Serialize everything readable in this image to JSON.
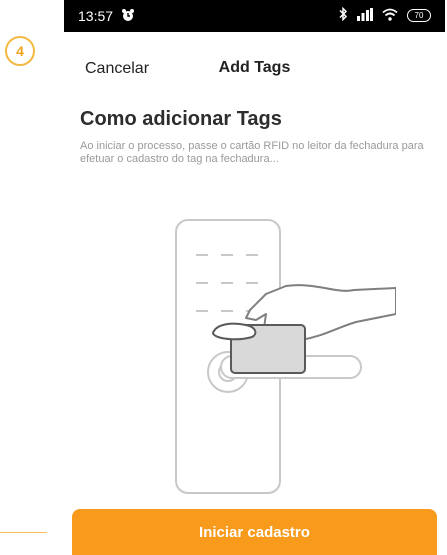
{
  "step": {
    "number": "4",
    "color": "#f4b740"
  },
  "status_bar": {
    "time": "13:57",
    "battery": "70",
    "icons": [
      "alarm-icon",
      "bluetooth-icon",
      "signal-icon",
      "wifi-icon",
      "battery-icon"
    ]
  },
  "nav": {
    "cancel_label": "Cancelar",
    "title": "Add Tags"
  },
  "content": {
    "heading": "Como adicionar Tags",
    "description": "Ao iniciar o processo, passe o cartão RFID no leitor da fechadura para efetuar o cadastro do tag na fechadura..."
  },
  "cta": {
    "label": "Iniciar cadastro",
    "color": "#f89b1c"
  }
}
